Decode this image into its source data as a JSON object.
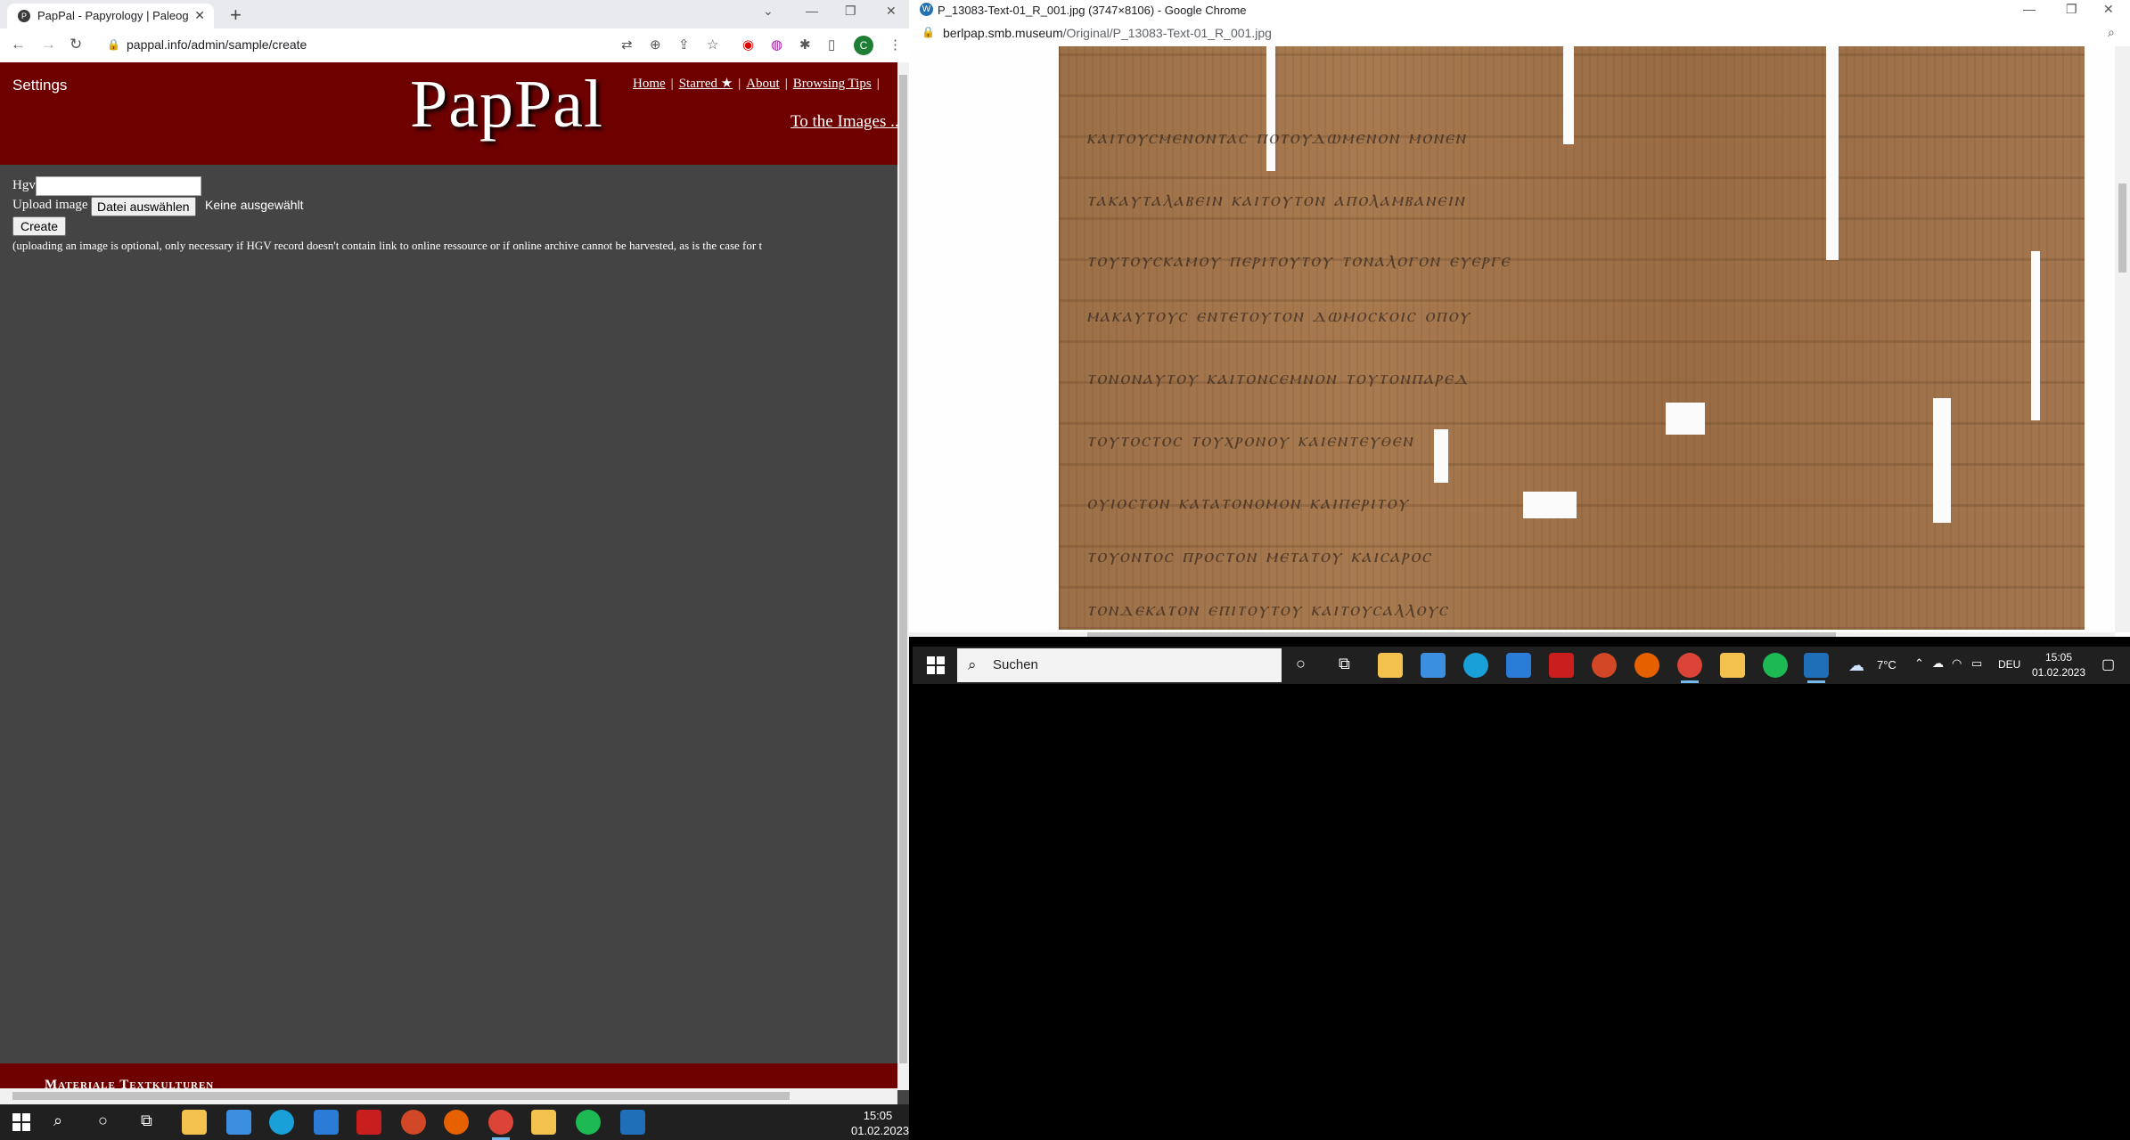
{
  "left_browser": {
    "tab_title": "PapPal - Papyrology | Paleograph",
    "url": "pappal.info/admin/sample/create",
    "profile_initial": "C"
  },
  "pappal": {
    "settings_label": "Settings",
    "logo": "PapPal",
    "nav": [
      "Home",
      "Starred ★",
      "About",
      "Browsing Tips"
    ],
    "nav_overflow": "|",
    "to_images": "To the Images ...",
    "hgv_label": "Hgv",
    "upload_label": "Upload image",
    "file_button": "Datei auswählen",
    "file_status": "Keine ausgewählt",
    "create_button": "Create",
    "note": "(uploading an image is optional, only necessary if HGV record doesn't contain link to online ressource or if online archive cannot be harvested, as is the case for t",
    "footer": "Materiale Textkulturen"
  },
  "right_browser": {
    "window_title": "P_13083-Text-01_R_001.jpg (3747×8106) - Google Chrome",
    "url_host": "berlpap.smb.museum",
    "url_path": "/Original/P_13083-Text-01_R_001.jpg"
  },
  "taskbar_left": {
    "time": "15:05",
    "date": "01.02.2023"
  },
  "taskbar_right": {
    "search_placeholder": "Suchen",
    "weather": "7°C",
    "language": "DEU",
    "time": "15:05",
    "date": "01.02.2023"
  }
}
